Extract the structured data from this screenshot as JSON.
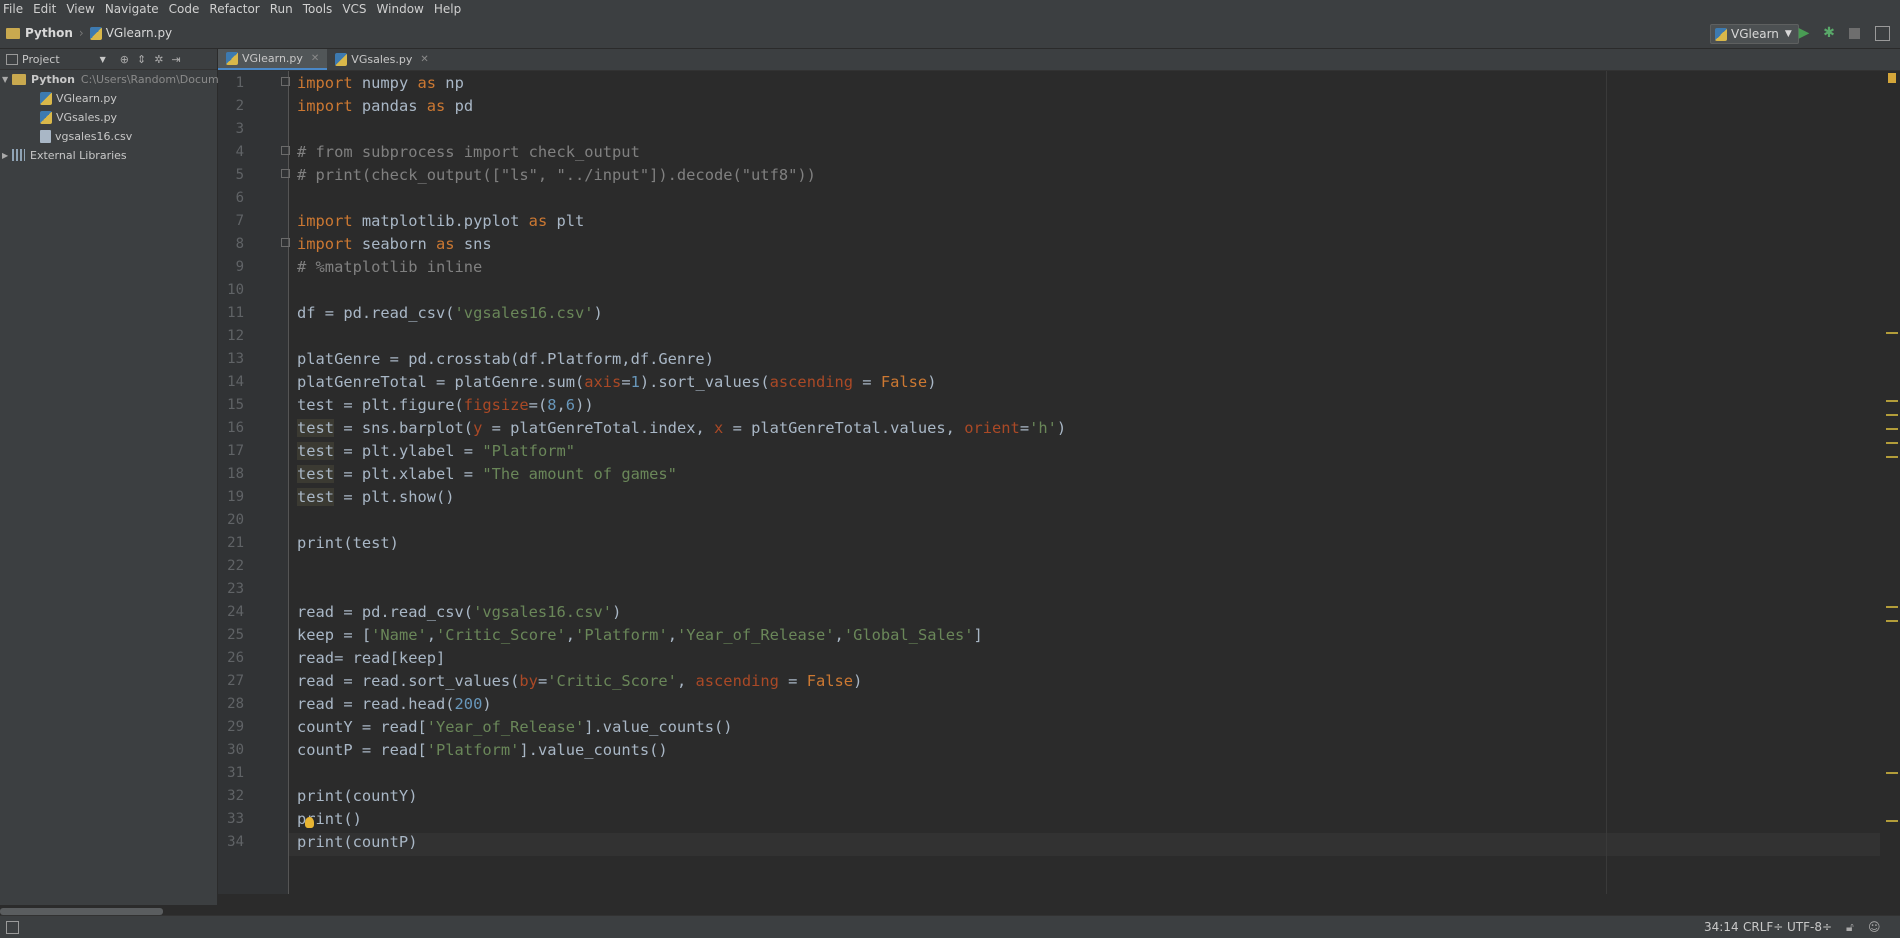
{
  "menu": [
    "File",
    "Edit",
    "View",
    "Navigate",
    "Code",
    "Refactor",
    "Run",
    "Tools",
    "VCS",
    "Window",
    "Help"
  ],
  "breadcrumb": {
    "project": "Python",
    "file": "VGlearn.py"
  },
  "run_config": {
    "name": "VGlearn"
  },
  "project_panel": {
    "title": "Project",
    "root": {
      "name": "Python",
      "path": "C:\\Users\\Random\\Docum"
    },
    "files": [
      "VGlearn.py",
      "VGsales.py",
      "vgsales16.csv"
    ],
    "external": "External Libraries"
  },
  "tabs": [
    {
      "label": "VGlearn.py",
      "active": true
    },
    {
      "label": "VGsales.py",
      "active": false
    }
  ],
  "line_numbers": [
    "1",
    "2",
    "3",
    "4",
    "5",
    "6",
    "7",
    "8",
    "9",
    "10",
    "11",
    "12",
    "13",
    "14",
    "15",
    "16",
    "17",
    "18",
    "19",
    "20",
    "21",
    "22",
    "23",
    "24",
    "25",
    "26",
    "27",
    "28",
    "29",
    "30",
    "31",
    "32",
    "33",
    "34"
  ],
  "code": [
    "import numpy as np",
    "import pandas as pd",
    "",
    "# from subprocess import check_output",
    "# print(check_output([\"ls\", \"../input\"]).decode(\"utf8\"))",
    "",
    "import matplotlib.pyplot as plt",
    "import seaborn as sns",
    "# %matplotlib inline",
    "",
    "df = pd.read_csv('vgsales16.csv')",
    "",
    "platGenre = pd.crosstab(df.Platform,df.Genre)",
    "platGenreTotal = platGenre.sum(axis=1).sort_values(ascending = False)",
    "test = plt.figure(figsize=(8,6))",
    "test = sns.barplot(y = platGenreTotal.index, x = platGenreTotal.values, orient='h')",
    "test = plt.ylabel = \"Platform\"",
    "test = plt.xlabel = \"The amount of games\"",
    "test = plt.show()",
    "",
    "print(test)",
    "",
    "",
    "read = pd.read_csv('vgsales16.csv')",
    "keep = ['Name','Critic_Score','Platform','Year_of_Release','Global_Sales']",
    "read= read[keep]",
    "read = read.sort_values(by='Critic_Score', ascending = False)",
    "read = read.head(200)",
    "countY = read['Year_of_Release'].value_counts()",
    "countP = read['Platform'].value_counts()",
    "",
    "print(countY)",
    "print()",
    "print(countP)"
  ],
  "status": {
    "position": "34:14",
    "line_sep": "CRLF÷",
    "encoding": "UTF-8÷"
  },
  "colors": {
    "keyword": "#cc7832",
    "string": "#6a8759",
    "number": "#6897bb",
    "comment": "#808080",
    "param": "#aa4926",
    "text": "#a9b7c6"
  }
}
